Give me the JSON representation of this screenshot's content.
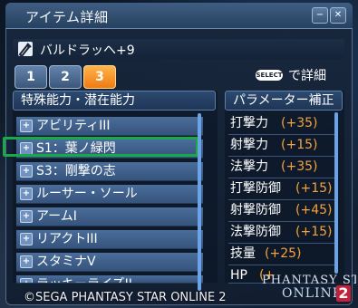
{
  "window": {
    "title": "アイテム詳細"
  },
  "item": {
    "name": "バルドラッヘ+9"
  },
  "tabs": [
    "1",
    "2",
    "3"
  ],
  "active_tab": "3",
  "select_hint": {
    "key": "SELECT",
    "label": "で詳細"
  },
  "abilities": {
    "header": "特殊能力・潜在能力",
    "items": [
      {
        "label": "アビリティIII"
      },
      {
        "label": "S1：葉ノ緑閃"
      },
      {
        "label": "S3：剛撃の志"
      },
      {
        "label": "ルーサー・ソール"
      },
      {
        "label": "アームI"
      },
      {
        "label": "リアクトIII"
      },
      {
        "label": "スタミナV"
      },
      {
        "label": "ラッキーライズII"
      }
    ]
  },
  "parameters": {
    "header": "パラメーター補正",
    "items": [
      {
        "name": "打撃力",
        "value": "(+35)"
      },
      {
        "name": "射撃力",
        "value": "(+15)"
      },
      {
        "name": "法撃力",
        "value": "(+35)"
      },
      {
        "name": "打撃防御",
        "value": "(+15)"
      },
      {
        "name": "射撃防御",
        "value": "(+45)"
      },
      {
        "name": "法撃防御",
        "value": "(+15)"
      },
      {
        "name": "技量",
        "value": "(+25)"
      },
      {
        "name": "HP",
        "value": "(+"
      }
    ]
  },
  "footer": {
    "copyright": "©SEGA PHANTASY STAR ONLINE 2"
  },
  "logo": {
    "line1": "PHANTASY STAR",
    "line2": "ONLINE",
    "num": "2"
  },
  "colors": {
    "active_tab": "#f07a12",
    "highlight": "#19a84a",
    "value_text": "#f6a23a"
  }
}
